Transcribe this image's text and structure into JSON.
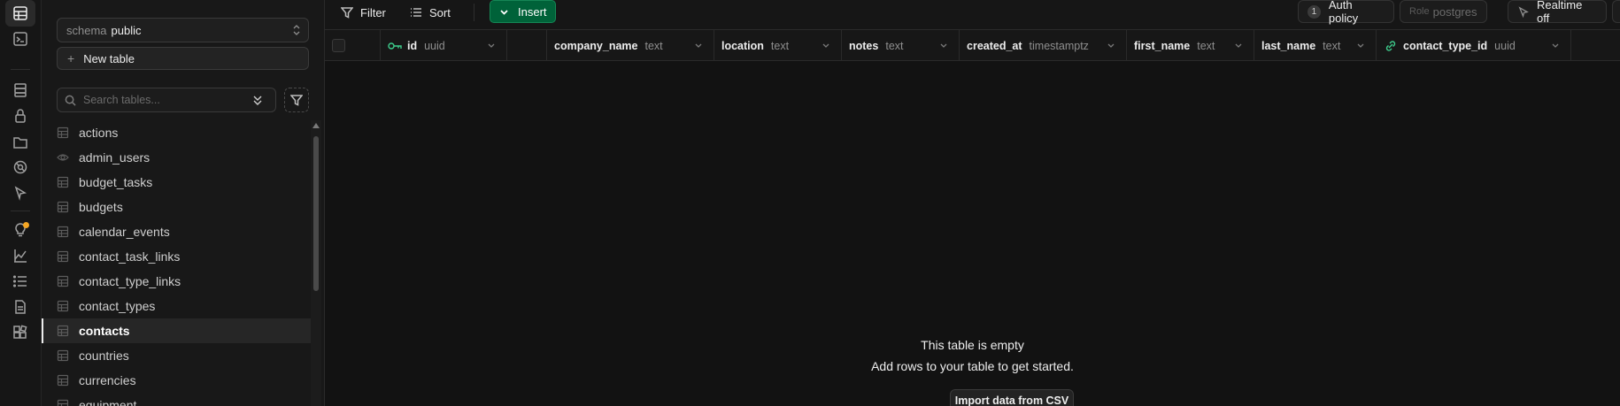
{
  "rail": {
    "icons": [
      "table-editor-icon",
      "sql-editor-icon",
      "database-icon",
      "auth-icon",
      "storage-icon",
      "realtime-icon",
      "edge-functions-icon",
      "advisors-icon",
      "reports-icon",
      "logs-icon",
      "api-docs-icon",
      "integrations-icon"
    ]
  },
  "sidebar": {
    "schema_label": "schema",
    "schema_value": "public",
    "new_table_label": "New table",
    "search_placeholder": "Search tables...",
    "tables": [
      {
        "name": "actions",
        "kind": "table"
      },
      {
        "name": "admin_users",
        "kind": "view"
      },
      {
        "name": "budget_tasks",
        "kind": "table"
      },
      {
        "name": "budgets",
        "kind": "table"
      },
      {
        "name": "calendar_events",
        "kind": "table"
      },
      {
        "name": "contact_task_links",
        "kind": "table"
      },
      {
        "name": "contact_type_links",
        "kind": "table"
      },
      {
        "name": "contact_types",
        "kind": "table"
      },
      {
        "name": "contacts",
        "kind": "table"
      },
      {
        "name": "countries",
        "kind": "table"
      },
      {
        "name": "currencies",
        "kind": "table"
      },
      {
        "name": "equipment",
        "kind": "table"
      }
    ],
    "active_table": "contacts"
  },
  "toolbar": {
    "filter_label": "Filter",
    "sort_label": "Sort",
    "insert_label": "Insert",
    "auth_policy_count": "1",
    "auth_policy_label": "Auth policy",
    "role_label": "Role",
    "role_value": "postgres",
    "realtime_label": "Realtime off"
  },
  "columns": [
    {
      "name": "id",
      "type": "uuid",
      "key": "primary"
    },
    {
      "name": "company_name",
      "type": "text",
      "key": ""
    },
    {
      "name": "location",
      "type": "text",
      "key": ""
    },
    {
      "name": "notes",
      "type": "text",
      "key": ""
    },
    {
      "name": "created_at",
      "type": "timestamptz",
      "key": ""
    },
    {
      "name": "first_name",
      "type": "text",
      "key": ""
    },
    {
      "name": "last_name",
      "type": "text",
      "key": ""
    },
    {
      "name": "contact_type_id",
      "type": "uuid",
      "key": "foreign"
    }
  ],
  "empty_state": {
    "title": "This table is empty",
    "subtitle": "Add rows to your table to get started.",
    "import_label": "Import data from CSV"
  },
  "colors": {
    "accent": "#3ecf8e",
    "insert_bg": "#006239",
    "notification": "#f5a623"
  }
}
